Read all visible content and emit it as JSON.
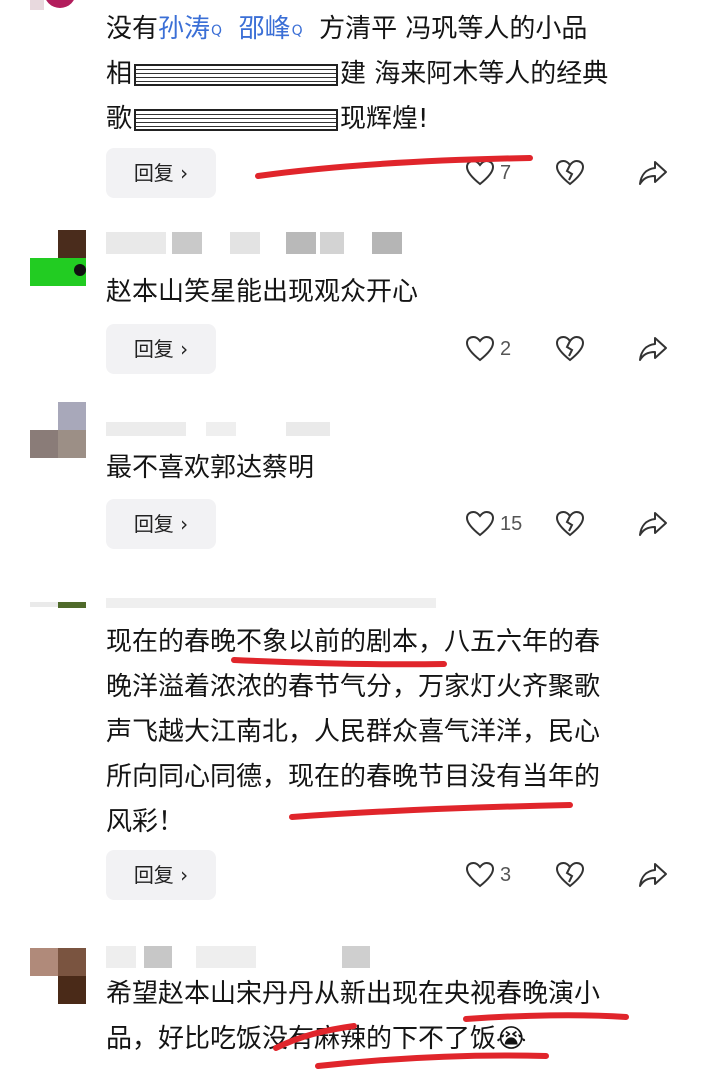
{
  "comments": [
    {
      "lines": [
        {
          "prefix": "没有",
          "link1": "孙涛",
          "link2": "邵峰",
          "rest": "方清平 冯巩等人的小品"
        },
        {
          "start": "相",
          "end": "建 海来阿木等人的经典"
        },
        {
          "start": "歌",
          "end": "现辉煌!"
        }
      ],
      "reply_label": "回复 ›",
      "likes": "7"
    },
    {
      "text": "赵本山笑星能出现观众开心",
      "reply_label": "回复 ›",
      "likes": "2"
    },
    {
      "text": "最不喜欢郭达蔡明",
      "reply_label": "回复 ›",
      "likes": "15"
    },
    {
      "lines": [
        "现在的春晚不象以前的剧本，八五六年的春",
        "晚洋溢着浓浓的春节气分，万家灯火齐聚歌",
        "声飞越大江南北，人民群众喜气洋洋，民心",
        "所向同心同德，现在的春晚节目没有当年的",
        "风彩！"
      ],
      "reply_label": "回复 ›",
      "likes": "3"
    },
    {
      "lines": [
        "希望赵本山宋丹丹从新出现在央视春晚演小",
        "品，好比吃饭没有麻辣的下不了饭"
      ],
      "emoji": "😭"
    }
  ],
  "colors": {
    "link": "#3b6fd6",
    "annotation": "#e0252b",
    "reply_bg": "#f2f2f4"
  }
}
